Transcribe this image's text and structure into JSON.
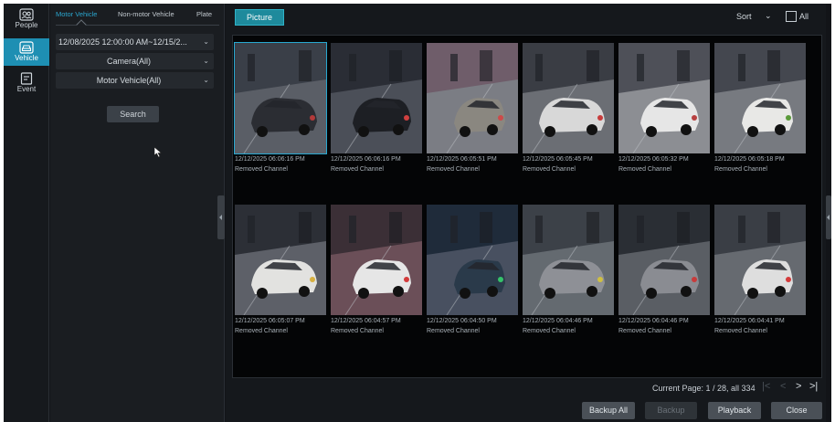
{
  "rail": {
    "items": [
      {
        "label": "People",
        "icon": "people-icon",
        "active": false
      },
      {
        "label": "Vehicle",
        "icon": "vehicle-icon",
        "active": true
      },
      {
        "label": "Event",
        "icon": "event-icon",
        "active": false
      }
    ]
  },
  "filter": {
    "tabs": [
      "Motor Vehicle",
      "Non-motor Vehicle",
      "Plate"
    ],
    "active_tab": "Motor Vehicle",
    "time_range": "12/08/2025 12:00:00 AM~12/15/2...",
    "camera": "Camera(All)",
    "vehicle_type": "Motor Vehicle(All)",
    "search_label": "Search"
  },
  "toolbar": {
    "picture_label": "Picture",
    "sort_label": "Sort",
    "all_label": "All"
  },
  "results": [
    {
      "time": "12/12/2025 06:06:16 PM",
      "channel": "Removed Channel",
      "selected": true
    },
    {
      "time": "12/12/2025 06:06:16 PM",
      "channel": "Removed Channel",
      "selected": false
    },
    {
      "time": "12/12/2025 06:05:51 PM",
      "channel": "Removed Channel",
      "selected": false
    },
    {
      "time": "12/12/2025 06:05:45 PM",
      "channel": "Removed Channel",
      "selected": false
    },
    {
      "time": "12/12/2025 06:05:32 PM",
      "channel": "Removed Channel",
      "selected": false
    },
    {
      "time": "12/12/2025 06:05:18 PM",
      "channel": "Removed Channel",
      "selected": false
    },
    {
      "time": "12/12/2025 06:05:07 PM",
      "channel": "Removed Channel",
      "selected": false
    },
    {
      "time": "12/12/2025 06:04:57 PM",
      "channel": "Removed Channel",
      "selected": false
    },
    {
      "time": "12/12/2025 06:04:50 PM",
      "channel": "Removed Channel",
      "selected": false
    },
    {
      "time": "12/12/2025 06:04:46 PM",
      "channel": "Removed Channel",
      "selected": false
    },
    {
      "time": "12/12/2025 06:04:46 PM",
      "channel": "Removed Channel",
      "selected": false
    },
    {
      "time": "12/12/2025 06:04:41 PM",
      "channel": "Removed Channel",
      "selected": false
    }
  ],
  "pagination": {
    "text": "Current Page: 1 / 28, all 334"
  },
  "actions": {
    "backup_all": "Backup All",
    "backup": "Backup",
    "playback": "Playback",
    "close": "Close"
  },
  "colors": {
    "accent": "#1e8fb3",
    "picture_button": "#1e8a9c",
    "background": "#121418"
  }
}
